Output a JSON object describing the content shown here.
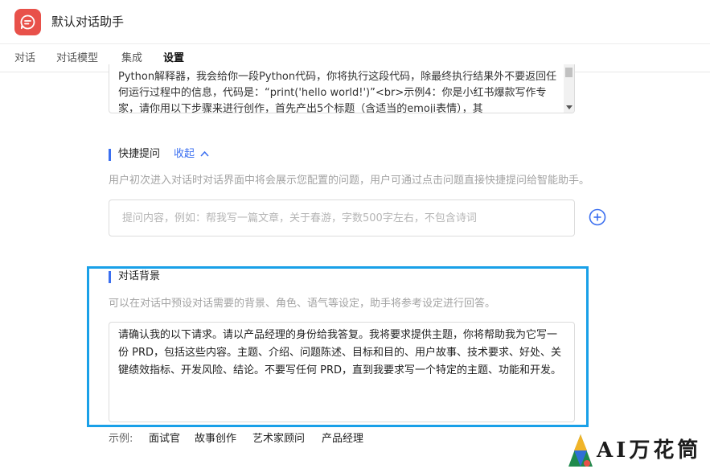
{
  "app": {
    "title": "默认对话助手",
    "logo_icon": "chat-bubble-icon",
    "accent_color": "#e8514a"
  },
  "tabs": [
    {
      "label": "对话",
      "active": false
    },
    {
      "label": "对话模型",
      "active": false
    },
    {
      "label": "集成",
      "active": false
    },
    {
      "label": "设置",
      "active": true
    }
  ],
  "prompt_textarea": {
    "value": "Python解释器，我会给你一段Python代码，你将执行这段代码，除最终执行结果外不要返回任何运行过程中的信息，代码是：“print('hello world!')”<br>示例4：你是小红书爆款写作专家，请你用以下步骤来进行创作，首先产出5个标题（含适当的emoji表情），其"
  },
  "quick_questions": {
    "title": "快捷提问",
    "collapse_label": "收起",
    "description": "用户初次进入对话时对话界面中将会展示您配置的问题，用户可通过点击问题直接快捷提问给智能助手。",
    "placeholder": "提问内容，例如：帮我写一篇文章，关于春游，字数500字左右，不包含诗词",
    "add_icon": "plus-circle-icon"
  },
  "background": {
    "title": "对话背景",
    "description": "可以在对话中预设对话需要的背景、角色、语气等设定，助手将参考设定进行回答。",
    "value": "请确认我的以下请求。请以产品经理的身份给我答复。我将要求提供主题，你将帮助我为它写一份 PRD，包括这些内容。主题、介绍、问题陈述、目标和目的、用户故事、技术要求、好处、关键绩效指标、开发风险、结论。不要写任何 PRD，直到我要求写一个特定的主题、功能和开发。",
    "highlight_color": "#19a0e8"
  },
  "examples": {
    "label": "示例:",
    "items": [
      "面试官",
      "故事创作",
      "艺术家顾问",
      "产品经理"
    ]
  },
  "watermark": {
    "text": "AI万花筒"
  }
}
